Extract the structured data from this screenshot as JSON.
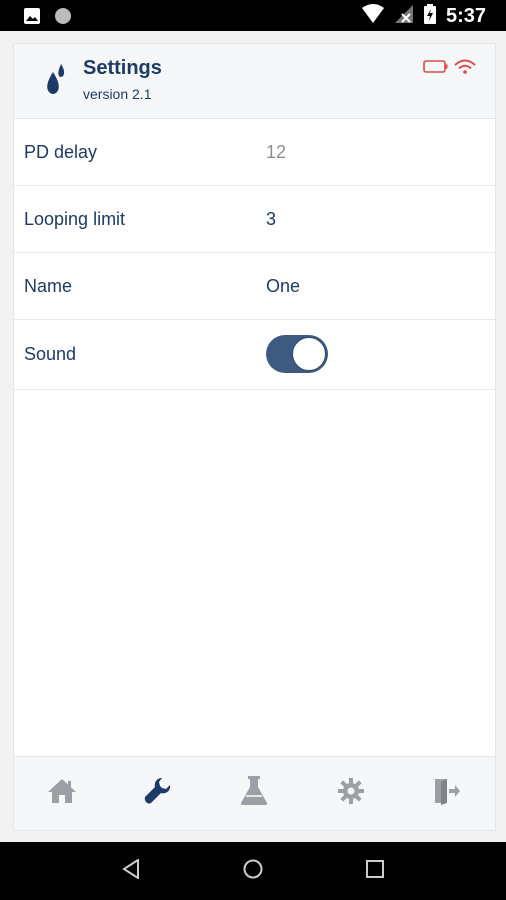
{
  "statusbar": {
    "time": "5:37",
    "icons": [
      "image-icon",
      "circle-icon",
      "wifi-icon",
      "no-signal-icon",
      "battery-icon"
    ]
  },
  "header": {
    "title": "Settings",
    "subtitle": "version 2.1",
    "logo_icon": "water-drops-icon",
    "status_icons": [
      "battery-empty-icon",
      "wifi-signal-icon"
    ],
    "status_color": "#e04848"
  },
  "settings": {
    "rows": [
      {
        "label": "PD delay",
        "value": "12"
      },
      {
        "label": "Looping limit",
        "value": "3"
      },
      {
        "label": "Name",
        "value": "One"
      },
      {
        "label": "Sound",
        "toggle": true
      }
    ]
  },
  "bottom_nav": {
    "items": [
      "home-icon",
      "wrench-icon",
      "flask-icon",
      "gear-icon",
      "exit-icon"
    ],
    "active_index": 1,
    "active_color": "#1e3a68",
    "inactive_color": "#9aa0a6"
  },
  "android_nav": [
    "back-icon",
    "home-circle-icon",
    "recents-icon"
  ],
  "colors": {
    "primary": "#1e3a68",
    "toggle_on": "#3d5a80"
  }
}
